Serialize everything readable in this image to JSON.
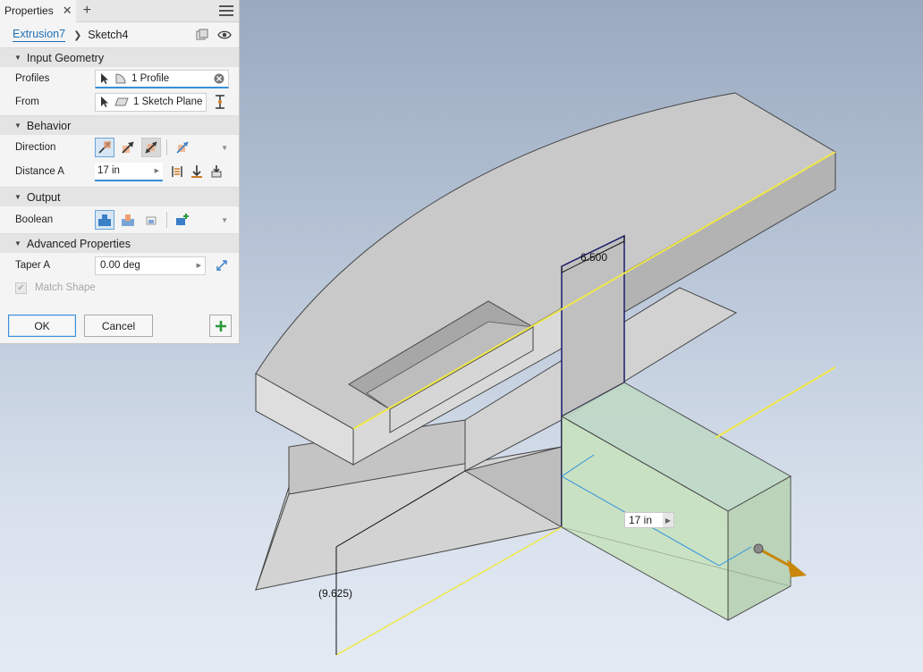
{
  "panel": {
    "tab_title": "Properties",
    "breadcrumb": {
      "parent": "Extrusion7",
      "current": "Sketch4"
    },
    "sections": {
      "input_geometry": "Input Geometry",
      "behavior": "Behavior",
      "output": "Output",
      "advanced": "Advanced Properties"
    },
    "fields": {
      "profiles": {
        "label": "Profiles",
        "value": "1 Profile"
      },
      "from": {
        "label": "From",
        "value": "1 Sketch Plane"
      },
      "direction": {
        "label": "Direction"
      },
      "distance_a": {
        "label": "Distance A",
        "value": "17 in"
      },
      "boolean": {
        "label": "Boolean"
      },
      "taper_a": {
        "label": "Taper A",
        "value": "0.00 deg"
      },
      "match_shape": {
        "label": "Match Shape",
        "checked": true,
        "enabled": false
      }
    },
    "buttons": {
      "ok": "OK",
      "cancel": "Cancel"
    }
  },
  "viewport": {
    "dimensions": {
      "width_dim": "6.500",
      "depth_dim": "(9.625)",
      "distance_input": "17 in"
    },
    "colors": {
      "body": "#c8c8c8",
      "preview": "#c9e2c2",
      "edge_highlight": "#f0e84a",
      "dimension": "#2d8fe0",
      "arrow": "#c8860a"
    }
  }
}
